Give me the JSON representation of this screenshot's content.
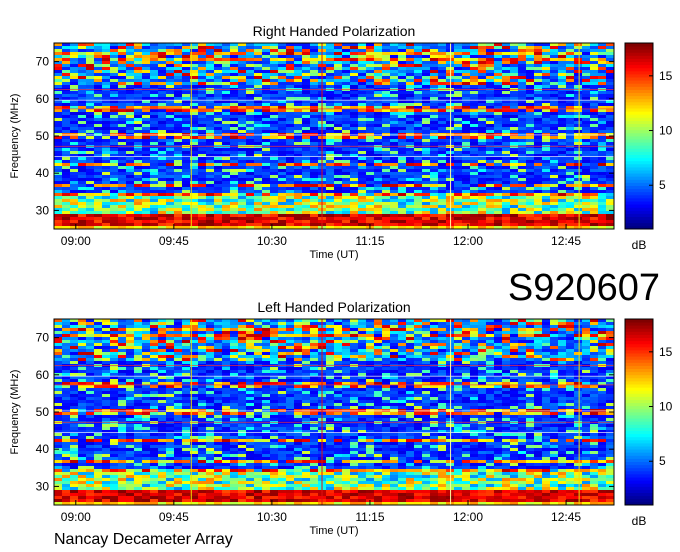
{
  "observation_id": "S920607",
  "footer": "Nancay Decameter Array",
  "chart_data": [
    {
      "type": "heatmap",
      "title": "Right Handed Polarization",
      "xlabel": "Time (UT)",
      "ylabel": "Frequency (MHz)",
      "x_ticks": [
        "09:00",
        "09:45",
        "10:30",
        "11:15",
        "12:00",
        "12:45"
      ],
      "y_ticks": [
        30,
        40,
        50,
        60,
        70
      ],
      "xlim": [
        "08:50",
        "13:07"
      ],
      "ylim": [
        25,
        75
      ],
      "colorbar": {
        "label": "dB",
        "ticks": [
          5,
          10,
          15
        ],
        "range": [
          1,
          18
        ],
        "colormap": "jet"
      },
      "vertical_markers": [
        {
          "time": "09:53",
          "color": "#f0e000"
        },
        {
          "time": "10:53",
          "color": "#e01010"
        },
        {
          "time": "11:52",
          "color": "#ffffa0"
        },
        {
          "time": "12:51",
          "color": "#f0e000"
        }
      ],
      "bright_band_below_MHz": 29,
      "busy_band_above_MHz": 64
    },
    {
      "type": "heatmap",
      "title": "Left Handed Polarization",
      "xlabel": "Time (UT)",
      "ylabel": "Frequency (MHz)",
      "x_ticks": [
        "09:00",
        "09:45",
        "10:30",
        "11:15",
        "12:00",
        "12:45"
      ],
      "y_ticks": [
        30,
        40,
        50,
        60,
        70
      ],
      "xlim": [
        "08:50",
        "13:07"
      ],
      "ylim": [
        25,
        75
      ],
      "colorbar": {
        "label": "dB",
        "ticks": [
          5,
          10,
          15
        ],
        "range": [
          1,
          18
        ],
        "colormap": "jet"
      },
      "vertical_markers": [
        {
          "time": "09:53",
          "color": "#f0e000"
        },
        {
          "time": "10:53",
          "color": "#e01010"
        },
        {
          "time": "11:52",
          "color": "#ffffa0"
        },
        {
          "time": "12:51",
          "color": "#f0e000"
        }
      ],
      "bright_band_below_MHz": 29,
      "busy_band_above_MHz": 64
    }
  ]
}
